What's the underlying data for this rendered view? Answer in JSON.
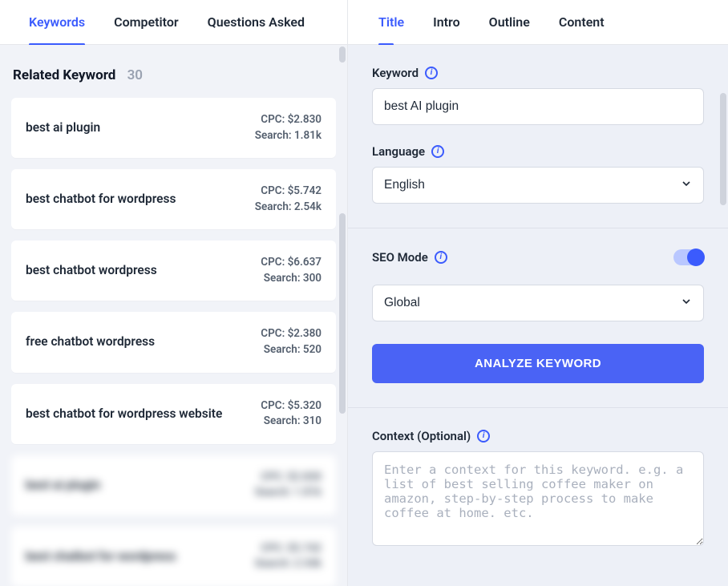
{
  "left": {
    "tabs": [
      {
        "label": "Keywords",
        "active": true
      },
      {
        "label": "Competitor",
        "active": false
      },
      {
        "label": "Questions Asked",
        "active": false
      }
    ],
    "related": {
      "title": "Related Keyword",
      "count": "30"
    },
    "keywords": [
      {
        "name": "best ai plugin",
        "cpc": "CPC: $2.830",
        "search": "Search: 1.81k",
        "blur": false
      },
      {
        "name": "best chatbot for wordpress",
        "cpc": "CPC: $5.742",
        "search": "Search: 2.54k",
        "blur": false
      },
      {
        "name": "best chatbot wordpress",
        "cpc": "CPC: $6.637",
        "search": "Search: 300",
        "blur": false
      },
      {
        "name": "free chatbot wordpress",
        "cpc": "CPC: $2.380",
        "search": "Search: 520",
        "blur": false
      },
      {
        "name": "best chatbot for wordpress website",
        "cpc": "CPC: $5.320",
        "search": "Search: 310",
        "blur": false
      },
      {
        "name": "best ai plugin",
        "cpc": "CPC: $2.830",
        "search": "Search: 1.81k",
        "blur": true
      },
      {
        "name": "best chatbot for wordpress",
        "cpc": "CPC: $5.742",
        "search": "Search: 2.54k",
        "blur": true
      }
    ]
  },
  "right": {
    "tabs": [
      {
        "label": "Title",
        "active": true
      },
      {
        "label": "Intro",
        "active": false
      },
      {
        "label": "Outline",
        "active": false
      },
      {
        "label": "Content",
        "active": false
      }
    ],
    "keyword": {
      "label": "Keyword",
      "value": "best AI plugin"
    },
    "language": {
      "label": "Language",
      "value": "English"
    },
    "seo": {
      "label": "SEO Mode",
      "region_value": "Global",
      "toggle_on": true
    },
    "analyze_btn": "ANALYZE KEYWORD",
    "context": {
      "label": "Context (Optional)",
      "placeholder": "Enter a context for this keyword. e.g. a list of best selling coffee maker on amazon, step-by-step process to make coffee at home. etc."
    }
  }
}
